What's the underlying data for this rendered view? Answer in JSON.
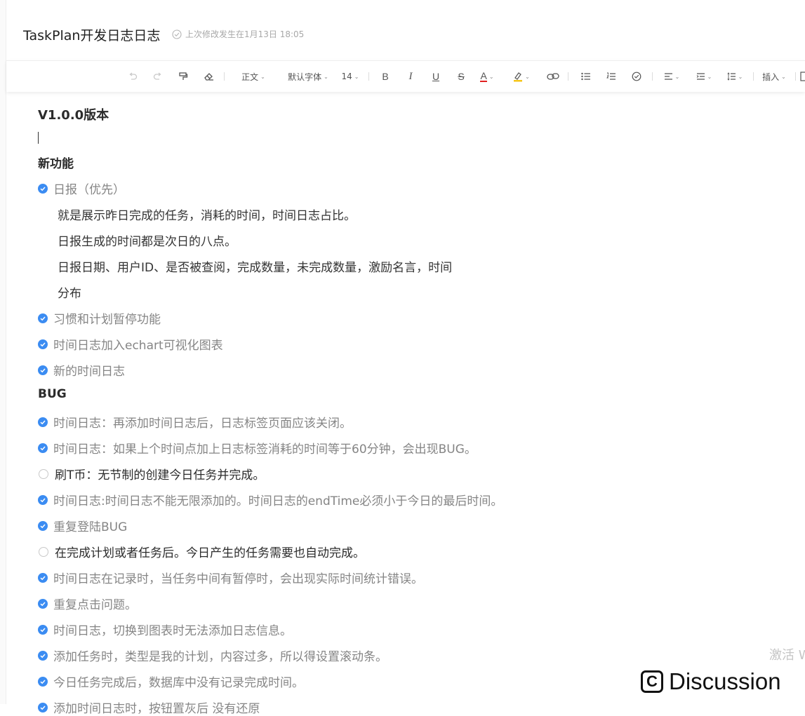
{
  "header": {
    "title": "TaskPlan开发日志日志",
    "save_status": "上次修改发生在1月13日 18:05"
  },
  "toolbar": {
    "paragraph_style": "正文",
    "font_family": "默认字体",
    "font_size": "14",
    "bold": "B",
    "italic": "I",
    "underline": "U",
    "strikethrough": "S",
    "font_color": "A",
    "insert": "插入",
    "font_color_hex": "#e02020",
    "highlight_color_hex": "#f5c518"
  },
  "document": {
    "version_heading": "V1.0.0版本",
    "features_heading": "新功能",
    "features": [
      {
        "text": "日报（优先）",
        "done": true
      },
      {
        "text": "习惯和计划暂停功能",
        "done": true
      },
      {
        "text": "时间日志加入echart可视化图表",
        "done": true
      },
      {
        "text": "新的时间日志",
        "done": true
      }
    ],
    "daily_report_details": [
      "就是展示昨日完成的任务，消耗的时间，时间日志占比。",
      "日报生成的时间都是次日的八点。",
      "日报日期、用户ID、是否被查阅，完成数量，未完成数量，激励名言，时间",
      "分布"
    ],
    "bug_heading": "BUG",
    "bugs": [
      {
        "text": "时间日志：再添加时间日志后，日志标签页面应该关闭。",
        "done": true
      },
      {
        "text": "时间日志：如果上个时间点加上日志标签消耗的时间等于60分钟，会出现BUG。",
        "done": true
      },
      {
        "text": "刷T币：无节制的创建今日任务并完成。",
        "done": false
      },
      {
        "text": "时间日志:时间日志不能无限添加的。时间日志的endTime必须小于今日的最后时间。",
        "done": true
      },
      {
        "text": "重复登陆BUG",
        "done": true
      },
      {
        "text": "在完成计划或者任务后。今日产生的任务需要也自动完成。",
        "done": false
      },
      {
        "text": "时间日志在记录时，当任务中间有暂停时，会出现实际时间统计错误。",
        "done": true
      },
      {
        "text": "重复点击问题。",
        "done": true
      },
      {
        "text": "时间日志，切换到图表时无法添加日志信息。",
        "done": true
      },
      {
        "text": "添加任务时，类型是我的计划，内容过多，所以得设置滚动条。",
        "done": true
      },
      {
        "text": "今日任务完成后，数据库中没有记录完成时间。",
        "done": true
      },
      {
        "text": "添加时间日志时，按钮置灰后 没有还原",
        "done": true
      }
    ]
  },
  "overlay": {
    "watermark": "激活 W",
    "discussion_label": "Discussion",
    "discussion_icon_letter": "C"
  }
}
